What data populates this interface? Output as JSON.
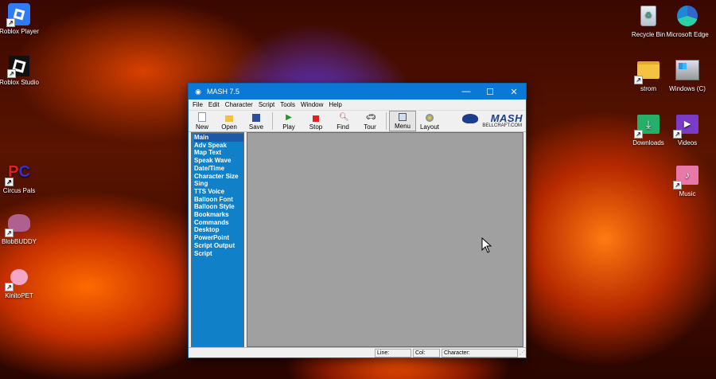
{
  "desktop": {
    "left_icons": [
      {
        "label": "Roblox Player",
        "icon": "roblox-player-icon"
      },
      {
        "label": "Roblox Studio",
        "icon": "roblox-studio-icon"
      },
      {
        "label": "Circus Pals",
        "icon": "circus-pals-icon"
      },
      {
        "label": "BlobBUDDY",
        "icon": "blobbuddy-icon"
      },
      {
        "label": "KinitoPET",
        "icon": "kinitopet-icon"
      }
    ],
    "right_icons": [
      {
        "label": "Recycle Bin",
        "icon": "recycle-bin-icon"
      },
      {
        "label": "Microsoft Edge",
        "icon": "edge-icon"
      },
      {
        "label": "strom",
        "icon": "folder-icon"
      },
      {
        "label": "Windows (C)",
        "icon": "drive-icon"
      },
      {
        "label": "Downloads",
        "icon": "downloads-icon"
      },
      {
        "label": "Videos",
        "icon": "videos-icon"
      },
      {
        "label": "Music",
        "icon": "music-icon"
      }
    ]
  },
  "window": {
    "title": "MASH 7.5",
    "menu": [
      "File",
      "Edit",
      "Character",
      "Script",
      "Tools",
      "Window",
      "Help"
    ],
    "toolbar": [
      {
        "label": "New",
        "icon": "new-icon"
      },
      {
        "label": "Open",
        "icon": "open-icon"
      },
      {
        "label": "Save",
        "icon": "save-icon"
      },
      {
        "label": "Play",
        "icon": "play-icon"
      },
      {
        "label": "Stop",
        "icon": "stop-icon"
      },
      {
        "label": "Find",
        "icon": "find-icon"
      },
      {
        "label": "Tour",
        "icon": "tour-icon"
      },
      {
        "label": "Menu",
        "icon": "menu-icon"
      },
      {
        "label": "Layout",
        "icon": "layout-icon"
      }
    ],
    "logo": {
      "brand": "MASH",
      "site": "BELLCRAFT.COM"
    },
    "side_items": [
      "Main",
      "Adv Speak",
      "Map Text",
      "Speak Wave",
      "Date/Time",
      "Character Size",
      "Sing",
      "TTS Voice",
      "Balloon Font",
      "Balloon Style",
      "Bookmarks",
      "Commands",
      "Desktop",
      "PowerPoint",
      "Script Output",
      "Script"
    ],
    "status": {
      "line": "Line:",
      "col": "Col:",
      "character": "Character:"
    }
  },
  "colors": {
    "titlebar": "#0a78d7",
    "sidepanel": "#1080c8",
    "content": "#a0a0a0"
  }
}
